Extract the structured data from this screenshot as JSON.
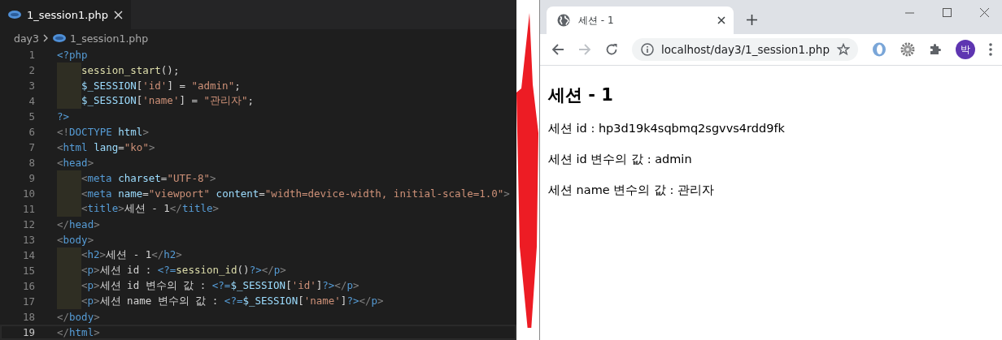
{
  "editor": {
    "tab": {
      "label": "1_session1.php",
      "selected": true
    },
    "breadcrumb": [
      "day3",
      "1_session1.php"
    ],
    "lines": [
      {
        "number": "1",
        "indented": false,
        "active": false,
        "tokens": [
          {
            "kind": "tag",
            "text": "<?php"
          }
        ]
      },
      {
        "number": "2",
        "indented": true,
        "active": false,
        "tokens": [
          {
            "kind": "fn",
            "text": "session_start"
          },
          {
            "kind": "text",
            "text": "();"
          }
        ]
      },
      {
        "number": "3",
        "indented": true,
        "active": false,
        "tokens": [
          {
            "kind": "var",
            "text": "$_SESSION"
          },
          {
            "kind": "text",
            "text": "["
          },
          {
            "kind": "str",
            "text": "'id'"
          },
          {
            "kind": "text",
            "text": "] = "
          },
          {
            "kind": "str",
            "text": "\"admin\""
          },
          {
            "kind": "text",
            "text": ";"
          }
        ]
      },
      {
        "number": "4",
        "indented": true,
        "active": false,
        "tokens": [
          {
            "kind": "var",
            "text": "$_SESSION"
          },
          {
            "kind": "text",
            "text": "["
          },
          {
            "kind": "str",
            "text": "'name'"
          },
          {
            "kind": "text",
            "text": "] = "
          },
          {
            "kind": "str",
            "text": "\"관리자\""
          },
          {
            "kind": "text",
            "text": ";"
          }
        ]
      },
      {
        "number": "5",
        "indented": false,
        "active": false,
        "tokens": [
          {
            "kind": "tag",
            "text": "?>"
          }
        ]
      },
      {
        "number": "6",
        "indented": false,
        "active": false,
        "tokens": [
          {
            "kind": "punct",
            "text": "<!"
          },
          {
            "kind": "tag",
            "text": "DOCTYPE"
          },
          {
            "kind": "attr",
            "text": " html"
          },
          {
            "kind": "punct",
            "text": ">"
          }
        ]
      },
      {
        "number": "7",
        "indented": false,
        "active": false,
        "tokens": [
          {
            "kind": "punct",
            "text": "<"
          },
          {
            "kind": "tag",
            "text": "html"
          },
          {
            "kind": "attr",
            "text": " lang"
          },
          {
            "kind": "text",
            "text": "="
          },
          {
            "kind": "str",
            "text": "\"ko\""
          },
          {
            "kind": "punct",
            "text": ">"
          }
        ]
      },
      {
        "number": "8",
        "indented": false,
        "active": false,
        "tokens": [
          {
            "kind": "punct",
            "text": "<"
          },
          {
            "kind": "tag",
            "text": "head"
          },
          {
            "kind": "punct",
            "text": ">"
          }
        ]
      },
      {
        "number": "9",
        "indented": true,
        "active": false,
        "tokens": [
          {
            "kind": "punct",
            "text": "<"
          },
          {
            "kind": "tag",
            "text": "meta"
          },
          {
            "kind": "attr",
            "text": " charset"
          },
          {
            "kind": "text",
            "text": "="
          },
          {
            "kind": "str",
            "text": "\"UTF-8\""
          },
          {
            "kind": "punct",
            "text": ">"
          }
        ]
      },
      {
        "number": "10",
        "indented": true,
        "active": false,
        "tokens": [
          {
            "kind": "punct",
            "text": "<"
          },
          {
            "kind": "tag",
            "text": "meta"
          },
          {
            "kind": "attr",
            "text": " name"
          },
          {
            "kind": "text",
            "text": "="
          },
          {
            "kind": "str",
            "text": "\"viewport\""
          },
          {
            "kind": "attr",
            "text": " content"
          },
          {
            "kind": "text",
            "text": "="
          },
          {
            "kind": "str",
            "text": "\"width=device-width, initial-scale=1.0\""
          },
          {
            "kind": "punct",
            "text": ">"
          }
        ]
      },
      {
        "number": "11",
        "indented": true,
        "active": false,
        "tokens": [
          {
            "kind": "punct",
            "text": "<"
          },
          {
            "kind": "tag",
            "text": "title"
          },
          {
            "kind": "punct",
            "text": ">"
          },
          {
            "kind": "text",
            "text": "세션 - 1"
          },
          {
            "kind": "punct",
            "text": "</"
          },
          {
            "kind": "tag",
            "text": "title"
          },
          {
            "kind": "punct",
            "text": ">"
          }
        ]
      },
      {
        "number": "12",
        "indented": false,
        "active": false,
        "tokens": [
          {
            "kind": "punct",
            "text": "</"
          },
          {
            "kind": "tag",
            "text": "head"
          },
          {
            "kind": "punct",
            "text": ">"
          }
        ]
      },
      {
        "number": "13",
        "indented": false,
        "active": false,
        "tokens": [
          {
            "kind": "punct",
            "text": "<"
          },
          {
            "kind": "tag",
            "text": "body"
          },
          {
            "kind": "punct",
            "text": ">"
          }
        ]
      },
      {
        "number": "14",
        "indented": true,
        "active": false,
        "tokens": [
          {
            "kind": "punct",
            "text": "<"
          },
          {
            "kind": "tag",
            "text": "h2"
          },
          {
            "kind": "punct",
            "text": ">"
          },
          {
            "kind": "text",
            "text": "세션 - 1"
          },
          {
            "kind": "punct",
            "text": "</"
          },
          {
            "kind": "tag",
            "text": "h2"
          },
          {
            "kind": "punct",
            "text": ">"
          }
        ]
      },
      {
        "number": "15",
        "indented": true,
        "active": false,
        "tokens": [
          {
            "kind": "punct",
            "text": "<"
          },
          {
            "kind": "tag",
            "text": "p"
          },
          {
            "kind": "punct",
            "text": ">"
          },
          {
            "kind": "text",
            "text": "세션 id : "
          },
          {
            "kind": "tag",
            "text": "<?="
          },
          {
            "kind": "fn",
            "text": "session_id"
          },
          {
            "kind": "text",
            "text": "()"
          },
          {
            "kind": "tag",
            "text": "?>"
          },
          {
            "kind": "punct",
            "text": "</"
          },
          {
            "kind": "tag",
            "text": "p"
          },
          {
            "kind": "punct",
            "text": ">"
          }
        ]
      },
      {
        "number": "16",
        "indented": true,
        "active": false,
        "tokens": [
          {
            "kind": "punct",
            "text": "<"
          },
          {
            "kind": "tag",
            "text": "p"
          },
          {
            "kind": "punct",
            "text": ">"
          },
          {
            "kind": "text",
            "text": "세션 id 변수의 값 : "
          },
          {
            "kind": "tag",
            "text": "<?="
          },
          {
            "kind": "var",
            "text": "$_SESSION"
          },
          {
            "kind": "text",
            "text": "["
          },
          {
            "kind": "str",
            "text": "'id'"
          },
          {
            "kind": "text",
            "text": "]"
          },
          {
            "kind": "tag",
            "text": "?>"
          },
          {
            "kind": "punct",
            "text": "</"
          },
          {
            "kind": "tag",
            "text": "p"
          },
          {
            "kind": "punct",
            "text": ">"
          }
        ]
      },
      {
        "number": "17",
        "indented": true,
        "active": false,
        "tokens": [
          {
            "kind": "punct",
            "text": "<"
          },
          {
            "kind": "tag",
            "text": "p"
          },
          {
            "kind": "punct",
            "text": ">"
          },
          {
            "kind": "text",
            "text": "세션 name 변수의 값 : "
          },
          {
            "kind": "tag",
            "text": "<?="
          },
          {
            "kind": "var",
            "text": "$_SESSION"
          },
          {
            "kind": "text",
            "text": "["
          },
          {
            "kind": "str",
            "text": "'name'"
          },
          {
            "kind": "text",
            "text": "]"
          },
          {
            "kind": "tag",
            "text": "?>"
          },
          {
            "kind": "punct",
            "text": "</"
          },
          {
            "kind": "tag",
            "text": "p"
          },
          {
            "kind": "punct",
            "text": ">"
          }
        ]
      },
      {
        "number": "18",
        "indented": false,
        "active": false,
        "tokens": [
          {
            "kind": "punct",
            "text": "</"
          },
          {
            "kind": "tag",
            "text": "body"
          },
          {
            "kind": "punct",
            "text": ">"
          }
        ]
      },
      {
        "number": "19",
        "indented": false,
        "active": true,
        "tokens": [
          {
            "kind": "punct",
            "text": "</"
          },
          {
            "kind": "tag",
            "text": "html"
          },
          {
            "kind": "punct",
            "text": ">"
          }
        ]
      }
    ]
  },
  "browser": {
    "tab": {
      "title": "세션 - 1",
      "selected": true
    },
    "address": "localhost/day3/1_session1.php",
    "forward_disabled": true,
    "avatar": "박",
    "page": {
      "heading": "세션 - 1",
      "paragraphs": [
        "세션 id : hp3d19k4sqbmq2sgvvs4rdd9fk",
        "세션 id 변수의 값 : admin",
        "세션 name 변수의 값 : 관리자"
      ]
    }
  }
}
